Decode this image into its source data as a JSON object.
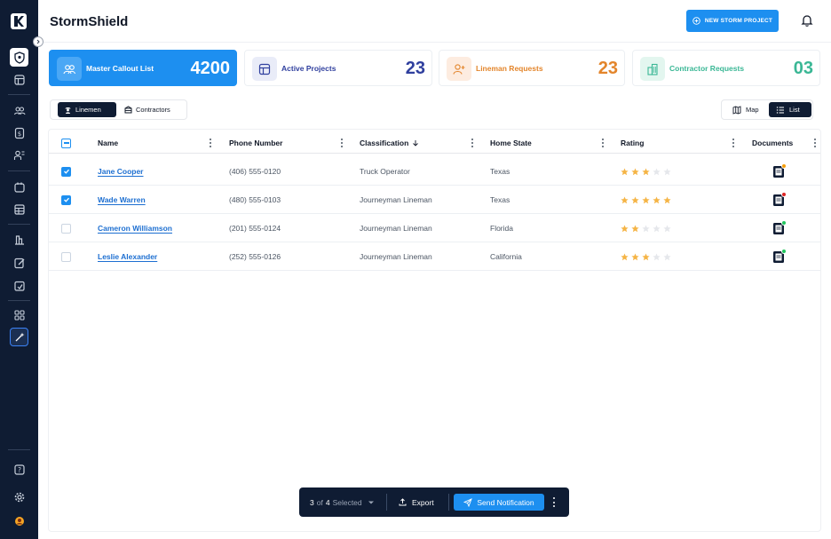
{
  "app": {
    "title": "StormShield"
  },
  "header": {
    "new_project_label": "NEW STORM PROJECT"
  },
  "sidebar": {
    "icons": [
      "shield-icon",
      "layout-icon",
      "users-icon",
      "dollar-icon",
      "people-icon",
      "calendar-icon",
      "grid-table-icon",
      "chart-icon",
      "edit-icon",
      "calendar-edit-icon",
      "dashboard-icon",
      "magic-icon"
    ],
    "bottom_icons": [
      "help-icon",
      "settings-icon",
      "avatar"
    ]
  },
  "cards": [
    {
      "label": "Master Callout List",
      "value": "4200",
      "color": "#ffffff",
      "icon_bg": "#4aa7f5",
      "icon": "users-icon"
    },
    {
      "label": "Active Projects",
      "value": "23",
      "color": "#2f3f9e",
      "icon_bg": "#e9ecf8",
      "icon": "layout-icon"
    },
    {
      "label": "Lineman Requests",
      "value": "23",
      "color": "#e3852b",
      "icon_bg": "#fdece0",
      "icon": "user-plus-icon"
    },
    {
      "label": "Contractor Requests",
      "value": "03",
      "color": "#3ab795",
      "icon_bg": "#e3f6ef",
      "icon": "building-icon"
    }
  ],
  "toggle": {
    "linemen": "Linemen",
    "contractors": "Contractors"
  },
  "view": {
    "map": "Map",
    "list": "List"
  },
  "table": {
    "columns": {
      "name": "Name",
      "phone": "Phone Number",
      "classification": "Classification",
      "state": "Home State",
      "rating": "Rating",
      "documents": "Documents"
    },
    "rows": [
      {
        "name": "Jane Cooper",
        "phone": "(406) 555-0120",
        "classification": "Truck Operator",
        "state": "Texas",
        "rating": 3,
        "checked": true,
        "doc_status": "#f59e0b"
      },
      {
        "name": "Wade Warren",
        "phone": "(480) 555-0103",
        "classification": "Journeyman Lineman",
        "state": "Texas",
        "rating": 5,
        "checked": true,
        "doc_status": "#dc2626"
      },
      {
        "name": "Cameron Williamson",
        "phone": "(201) 555-0124",
        "classification": "Journeyman Lineman",
        "state": "Florida",
        "rating": 2,
        "checked": false,
        "doc_status": "#22c55e"
      },
      {
        "name": "Leslie Alexander",
        "phone": "(252) 555-0126",
        "classification": "Journeyman Lineman",
        "state": "California",
        "rating": 3,
        "checked": false,
        "doc_status": "#22c55e"
      }
    ]
  },
  "actionbar": {
    "selected_count": "3",
    "of_text": "of",
    "total": "4",
    "selected_label": "Selected",
    "export_label": "Export",
    "send_label": "Send Notification"
  },
  "colors": {
    "accent": "#1d8ff0",
    "sidebar": "#0f1c33",
    "star_on": "#f5b445",
    "star_off": "#e5e7eb"
  }
}
